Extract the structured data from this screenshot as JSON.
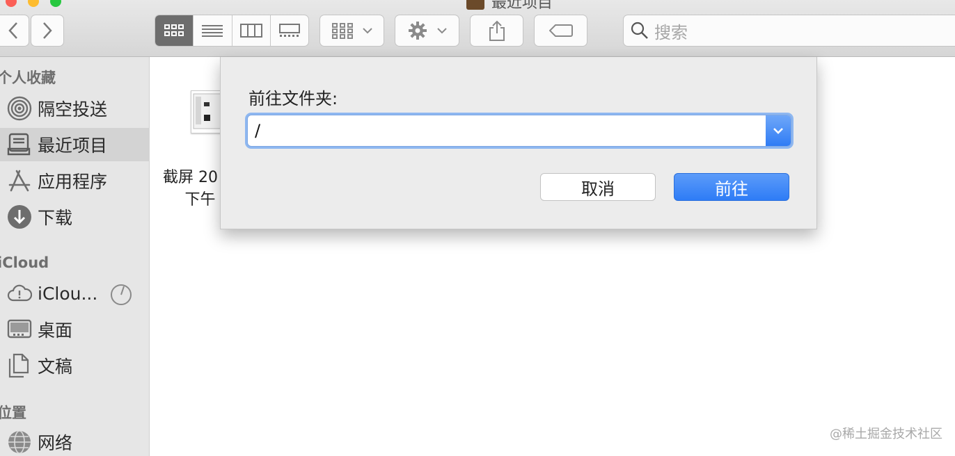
{
  "window": {
    "title": "最近项目"
  },
  "search": {
    "placeholder": "搜索"
  },
  "sidebar": {
    "sections": [
      {
        "title": "个人收藏"
      },
      {
        "title": "iCloud"
      },
      {
        "title": "位置"
      }
    ],
    "items": [
      {
        "label": "隔空投送",
        "icon": "airdrop-icon"
      },
      {
        "label": "最近项目",
        "icon": "recents-icon",
        "selected": true
      },
      {
        "label": "应用程序",
        "icon": "applications-icon"
      },
      {
        "label": "下载",
        "icon": "download-icon"
      },
      {
        "label": "iClou...",
        "icon": "icloud-drive-icon"
      },
      {
        "label": "桌面",
        "icon": "desktop-icon"
      },
      {
        "label": "文稿",
        "icon": "documents-icon"
      },
      {
        "label": "网络",
        "icon": "network-icon"
      }
    ]
  },
  "files": [
    {
      "name_line1": "截屏 20",
      "name_line2": "下午"
    }
  ],
  "dialog": {
    "label": "前往文件夹:",
    "path_value": "/",
    "cancel_label": "取消",
    "go_label": "前往"
  },
  "watermark": "@稀土掘金技术社区",
  "colors": {
    "accent": "#2e7cf6",
    "focus_ring": "#8eb7f0",
    "sidebar_bg": "#e6e6e6",
    "dialog_bg": "#ececec"
  }
}
